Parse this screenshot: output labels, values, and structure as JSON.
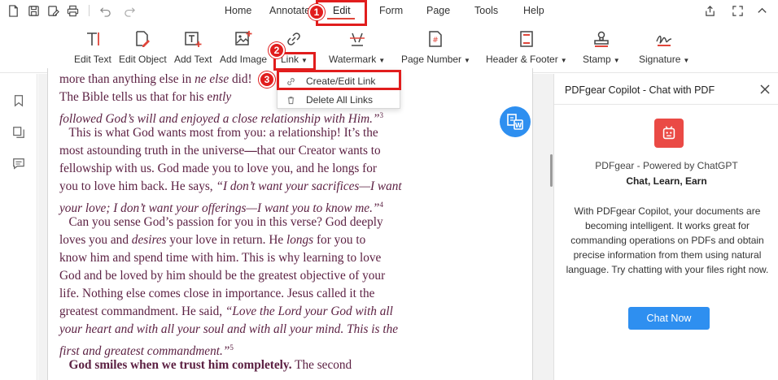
{
  "topbar": {
    "quick_icons": [
      "file-icon",
      "save-icon",
      "save-as-icon",
      "print-icon",
      "undo-icon",
      "redo-icon"
    ],
    "menu": [
      "Home",
      "Annotate",
      "Edit",
      "Form",
      "Page",
      "Tools",
      "Help"
    ],
    "active_menu": "Edit",
    "right_icons": [
      "share-icon",
      "fullscreen-icon",
      "collapse-icon"
    ]
  },
  "ribbon": {
    "tools": [
      {
        "label": "Edit Text",
        "icon": "edit-text-icon"
      },
      {
        "label": "Edit Object",
        "icon": "edit-object-icon"
      },
      {
        "label": "Add Text",
        "icon": "add-text-icon"
      },
      {
        "label": "Add Image",
        "icon": "add-image-icon"
      },
      {
        "label": "Link",
        "icon": "link-icon"
      },
      {
        "label": "Watermark",
        "icon": "watermark-icon"
      },
      {
        "label": "Page Number",
        "icon": "page-number-icon"
      },
      {
        "label": "Header & Footer",
        "icon": "header-footer-icon"
      },
      {
        "label": "Stamp",
        "icon": "stamp-icon"
      },
      {
        "label": "Signature",
        "icon": "signature-icon"
      }
    ]
  },
  "link_menu": {
    "items": [
      "Create/Edit Link",
      "Delete All Links"
    ]
  },
  "badges": [
    "1",
    "2",
    "3"
  ],
  "leftrail": [
    "bookmark-icon",
    "thumbnails-icon",
    "comments-icon"
  ],
  "document": {
    "lines": [
      {
        "parts": [
          {
            "t": "more than anything else in "
          },
          {
            "t": "ne else",
            "i": true
          },
          {
            "t": " did!"
          }
        ]
      },
      {
        "parts": [
          {
            "t": "The Bible tells us that for his e"
          },
          {
            "t": "ntly",
            "i": true
          }
        ]
      },
      {
        "parts": [
          {
            "t": "followed God’s will and enjoyed a close relationship with Him.”",
            "i": true
          },
          {
            "t": "3",
            "sup": true
          }
        ]
      },
      {
        "parts": [
          {
            "t": "   This is what God wants most from you: a relationship! It’s the"
          }
        ]
      },
      {
        "parts": [
          {
            "t": "most astounding truth in the universe"
          },
          {
            "t": "—",
            "b": true
          },
          {
            "t": "that our Creator wants to"
          }
        ]
      },
      {
        "parts": [
          {
            "t": "fellowship with us. God made you to love you, and he longs for"
          }
        ]
      },
      {
        "parts": [
          {
            "t": "you to love him back. He says, "
          },
          {
            "t": "“I don’t want your sacrifices—I want",
            "i": true
          }
        ]
      },
      {
        "parts": [
          {
            "t": "your love; I don’t want your offerings—I want you to know me.”",
            "i": true
          },
          {
            "t": "4",
            "sup": true
          }
        ]
      },
      {
        "parts": [
          {
            "t": "   Can you sense God’s passion for you in this verse? God deeply"
          }
        ]
      },
      {
        "parts": [
          {
            "t": "loves you and "
          },
          {
            "t": "desires",
            "i": true
          },
          {
            "t": " your love in return. He "
          },
          {
            "t": "longs",
            "i": true
          },
          {
            "t": " for you to"
          }
        ]
      },
      {
        "parts": [
          {
            "t": "know him and spend time with him. This is why learning to love"
          }
        ]
      },
      {
        "parts": [
          {
            "t": "God and be loved by him should be the greatest objective of your"
          }
        ]
      },
      {
        "parts": [
          {
            "t": "life. Nothing else comes close in importance. Jesus called it the"
          }
        ]
      },
      {
        "parts": [
          {
            "t": "greatest commandment. He said, "
          },
          {
            "t": "“Love the Lord your God with all",
            "i": true
          }
        ]
      },
      {
        "parts": [
          {
            "t": "your heart and with all your soul and with all your mind. This is the",
            "i": true
          }
        ]
      },
      {
        "parts": [
          {
            "t": "first and greatest commandment.”",
            "i": true
          },
          {
            "t": "5",
            "sup": true
          }
        ]
      },
      {
        "parts": [
          {
            "t": "   "
          },
          {
            "t": "God smiles when we trust him completely.",
            "b": true
          },
          {
            "t": " The second"
          }
        ]
      }
    ]
  },
  "copilot": {
    "title": "PDFgear Copilot - Chat with PDF",
    "powered": "PDFgear - Powered by ChatGPT",
    "tagline": "Chat, Learn, Earn",
    "description": "With PDFgear Copilot, your documents are becoming intelligent. It works great for commanding operations on PDFs and obtain precise information from them using natural language. Try chatting with your files right now.",
    "button": "Chat Now"
  },
  "colors": {
    "accent": "#e0453a",
    "highlight": "#e11d1d",
    "primary_button": "#2e8ff0",
    "document_text": "#5c2143",
    "copilot_logo": "#ea4a45"
  }
}
